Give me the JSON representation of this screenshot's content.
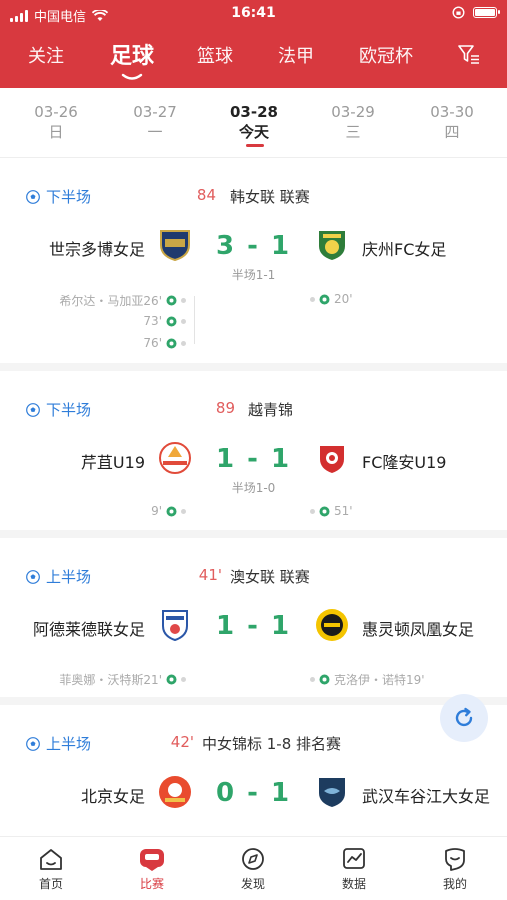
{
  "status": {
    "carrier": "中国电信",
    "time": "16:41"
  },
  "nav": {
    "items": [
      "关注",
      "足球",
      "篮球",
      "法甲",
      "欧冠杯"
    ],
    "active": "足球",
    "filter_icon": "filter-icon"
  },
  "dates": [
    {
      "date": "03-26",
      "day": "日"
    },
    {
      "date": "03-27",
      "day": "一"
    },
    {
      "date": "03-28",
      "day": "今天"
    },
    {
      "date": "03-29",
      "day": "三"
    },
    {
      "date": "03-30",
      "day": "四"
    }
  ],
  "matches": [
    {
      "period": "下半场",
      "minute": "84",
      "league": "韩女联 联赛",
      "home": "世宗多博女足",
      "away": "庆州FC女足",
      "score": "3 - 1",
      "half": "半场1-1",
      "home_events": [
        "希尔达・马加亚26'",
        "73'",
        "76'"
      ],
      "away_events": [
        "20'"
      ]
    },
    {
      "period": "下半场",
      "minute": "89",
      "league": "越青锦",
      "home": "芹苴U19",
      "away": "FC隆安U19",
      "score": "1 - 1",
      "half": "半场1-0",
      "home_events": [
        "9'"
      ],
      "away_events": [
        "51'"
      ]
    },
    {
      "period": "上半场",
      "minute": "41'",
      "league": "澳女联 联赛",
      "home": "阿德莱德联女足",
      "away": "惠灵顿凤凰女足",
      "score": "1 - 1",
      "half": "",
      "home_events": [
        "菲奥娜・沃特斯21'"
      ],
      "away_events": [
        "克洛伊・诺特19'"
      ]
    },
    {
      "period": "上半场",
      "minute": "42'",
      "league": "中女锦标 1-8 排名赛",
      "home": "北京女足",
      "away": "武汉车谷江大女足",
      "score": "0 - 1",
      "half": ""
    }
  ],
  "tabs": [
    {
      "label": "首页",
      "icon": "home-icon"
    },
    {
      "label": "比赛",
      "icon": "match-icon"
    },
    {
      "label": "发现",
      "icon": "discover-icon"
    },
    {
      "label": "数据",
      "icon": "data-icon"
    },
    {
      "label": "我的",
      "icon": "profile-icon"
    }
  ],
  "colors": {
    "brand": "#d8393f",
    "score": "#2fa56a",
    "period": "#2f7dd9",
    "minute": "#e15d5d"
  }
}
